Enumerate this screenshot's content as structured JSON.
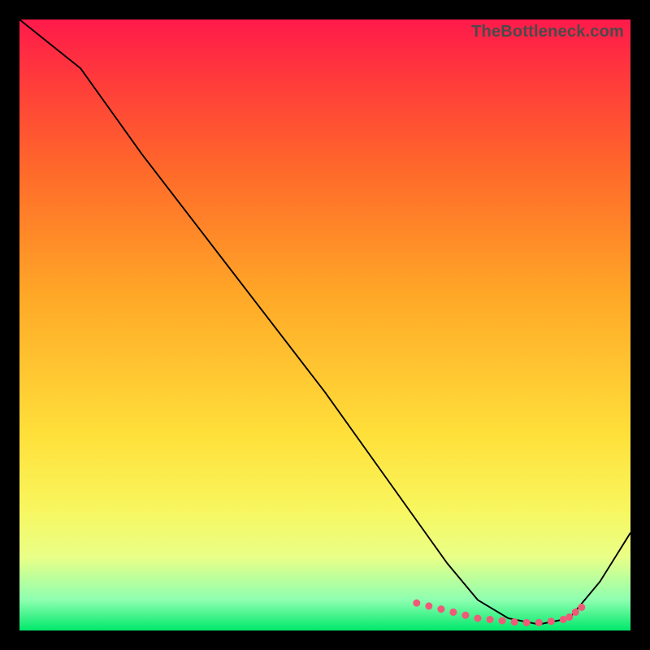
{
  "watermark": "TheBottleneck.com",
  "chart_data": {
    "type": "line",
    "title": "",
    "xlabel": "",
    "ylabel": "",
    "xlim": [
      0,
      100
    ],
    "ylim": [
      0,
      100
    ],
    "series": [
      {
        "name": "curve",
        "x": [
          0,
          5,
          10,
          20,
          30,
          40,
          50,
          60,
          65,
          70,
          75,
          80,
          85,
          90,
          95,
          100
        ],
        "y": [
          100,
          96,
          92,
          78,
          65,
          52,
          39,
          25,
          18,
          11,
          5,
          2,
          1,
          2,
          8,
          16
        ]
      }
    ],
    "marker_points": {
      "name": "markers",
      "x": [
        65,
        67,
        69,
        71,
        73,
        75,
        77,
        79,
        81,
        83,
        85,
        87,
        89,
        90,
        91,
        92
      ],
      "y": [
        4.5,
        4,
        3.5,
        3,
        2.5,
        2,
        1.8,
        1.6,
        1.4,
        1.3,
        1.3,
        1.5,
        1.8,
        2.2,
        3.0,
        3.8
      ]
    },
    "colors": {
      "curve": "#000000",
      "markers": "#ef5a78"
    }
  }
}
